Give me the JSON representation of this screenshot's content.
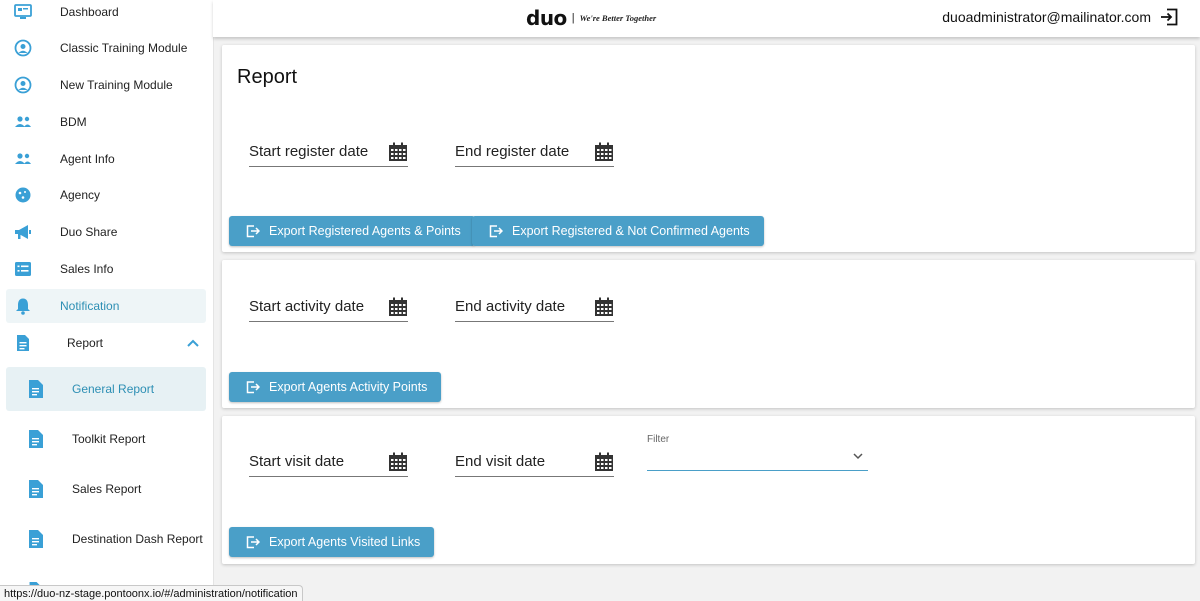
{
  "colors": {
    "accent": "#4a9fc8",
    "icon_blue": "#3aa0d6",
    "active_text": "#2d8fb4"
  },
  "sidebar": {
    "items": [
      {
        "label": "Dashboard",
        "icon": "monitor-icon"
      },
      {
        "label": "Classic Training Module",
        "icon": "graduate-icon"
      },
      {
        "label": "New Training Module",
        "icon": "graduate-icon"
      },
      {
        "label": "BDM",
        "icon": "people-icon"
      },
      {
        "label": "Agent Info",
        "icon": "people-icon"
      },
      {
        "label": "Agency",
        "icon": "cookie-icon"
      },
      {
        "label": "Duo Share",
        "icon": "megaphone-icon"
      },
      {
        "label": "Sales Info",
        "icon": "list-icon"
      },
      {
        "label": "Notification",
        "icon": "bell-icon"
      },
      {
        "label": "Report",
        "icon": "document-icon",
        "expanded": true
      }
    ],
    "report_sub": [
      {
        "label": "General Report",
        "active": true
      },
      {
        "label": "Toolkit Report"
      },
      {
        "label": "Sales Report"
      },
      {
        "label": "Destination Dash Report"
      }
    ]
  },
  "header": {
    "logo": "duo",
    "separator": "|",
    "tagline": "We're Better Together",
    "user_email": "duoadministrator@mailinator.com"
  },
  "report": {
    "title": "Report",
    "section1": {
      "start_label": "Start register date",
      "end_label": "End register date",
      "btn1": "Export Registered Agents & Points",
      "btn2": "Export Registered & Not Confirmed Agents"
    },
    "section2": {
      "start_label": "Start activity date",
      "end_label": "End activity date",
      "btn1": "Export Agents Activity Points"
    },
    "section3": {
      "start_label": "Start visit date",
      "end_label": "End visit date",
      "filter_label": "Filter",
      "filter_value": "",
      "btn1": "Export Agents Visited Links"
    }
  },
  "status_bar": {
    "url": "https://duo-nz-stage.pontoonx.io/#/administration/notification"
  }
}
